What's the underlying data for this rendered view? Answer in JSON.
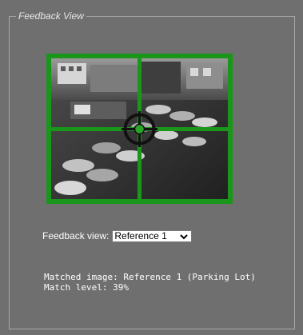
{
  "panel": {
    "legend": "Feedback View"
  },
  "feed": {
    "frame_color": "#1a961a",
    "reticle_icon": "crosshair-icon",
    "image_description_icon": "camera-feed-image"
  },
  "selector": {
    "label": "Feedback view:",
    "selected": "Reference 1",
    "options": [
      "Reference 1"
    ]
  },
  "status": {
    "matched_line": "Matched image: Reference 1 (Parking Lot)",
    "match_line": "Match level: 39%",
    "match_level_percent": 39
  }
}
